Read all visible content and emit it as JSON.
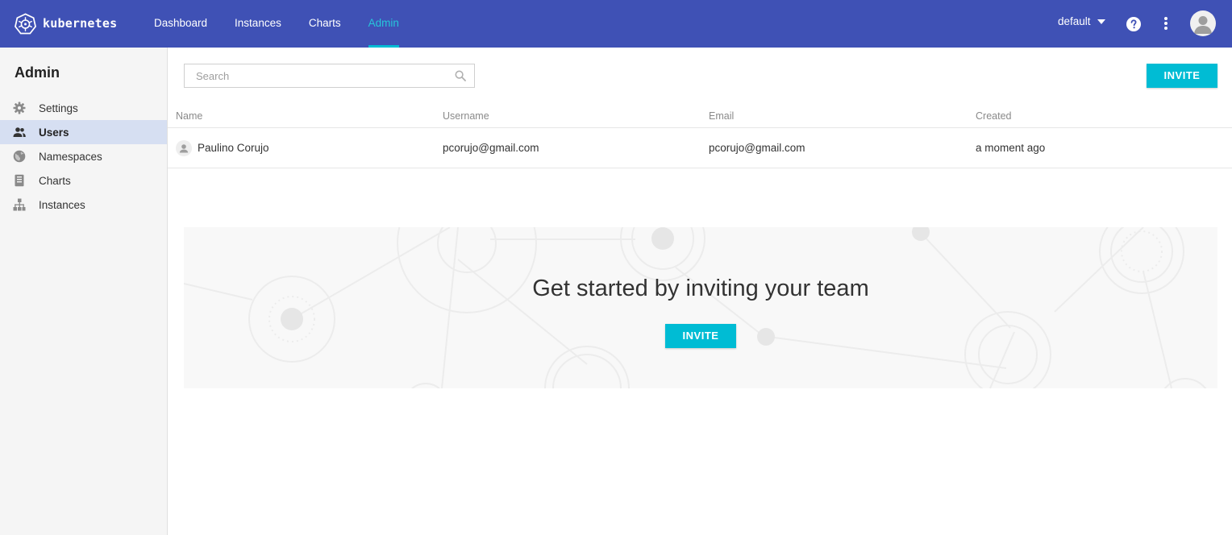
{
  "brand": {
    "name": "kubernetes"
  },
  "nav": {
    "items": [
      {
        "label": "Dashboard",
        "active": false
      },
      {
        "label": "Instances",
        "active": false
      },
      {
        "label": "Charts",
        "active": false
      },
      {
        "label": "Admin",
        "active": true
      }
    ]
  },
  "header": {
    "namespace": "default",
    "icons": [
      "help-icon",
      "more-vert-icon",
      "account-icon"
    ]
  },
  "colors": {
    "topbar": "#3f51b5",
    "accent": "#00bcd4",
    "sidebar_active": "#d6dff2"
  },
  "sidebar": {
    "title": "Admin",
    "items": [
      {
        "label": "Settings",
        "icon": "gear-icon",
        "active": false
      },
      {
        "label": "Users",
        "icon": "people-icon",
        "active": true
      },
      {
        "label": "Namespaces",
        "icon": "globe-icon",
        "active": false
      },
      {
        "label": "Charts",
        "icon": "chart-book-icon",
        "active": false
      },
      {
        "label": "Instances",
        "icon": "hierarchy-icon",
        "active": false
      }
    ]
  },
  "search": {
    "placeholder": "Search",
    "value": ""
  },
  "toolbar": {
    "invite_label": "INVITE"
  },
  "table": {
    "columns": [
      "Name",
      "Username",
      "Email",
      "Created"
    ],
    "rows": [
      {
        "name": "Paulino Corujo",
        "username": "pcorujo@gmail.com",
        "email": "pcorujo@gmail.com",
        "created": "a moment ago"
      }
    ]
  },
  "empty_state": {
    "heading": "Get started by inviting your team",
    "button_label": "INVITE"
  }
}
